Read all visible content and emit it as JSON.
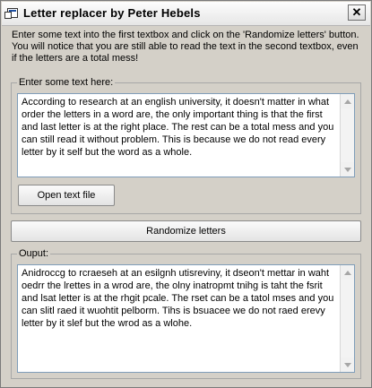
{
  "window": {
    "title": "Letter replacer by Peter Hebels",
    "close_glyph": "✕"
  },
  "intro": {
    "text": "Enter some text into the first textbox and click on the 'Randomize letters' button. You will notice that you are still able to read the text in the second textbox, even if the letters are a total mess!"
  },
  "input_group": {
    "label": "Enter some text here:",
    "text": "According to research at an english university, it doesn't matter in what order the letters in a word are, the only important thing is that the first and last letter is at the right place. The rest can be a total mess and you can still read it without problem. This is because we do not read every letter by it self but the word as a whole.",
    "open_button": "Open text file"
  },
  "randomize_button": "Randomize letters",
  "output_group": {
    "label": "Ouput:",
    "text": "Anidroccg to rcraeseh at an esilgnh utisreviny, it dseon't mettar in waht oedrr the lrettes in a wrod are, the olny inatropmt tnihg is taht the fsrit and lsat letter is at the rhgit pcale. The rset can be a tatol mses and you can slitl raed it wuohtit pelborm. Tihs is bsuacee we do not raed erevy letter by it slef but the wrod as a wlohe."
  }
}
